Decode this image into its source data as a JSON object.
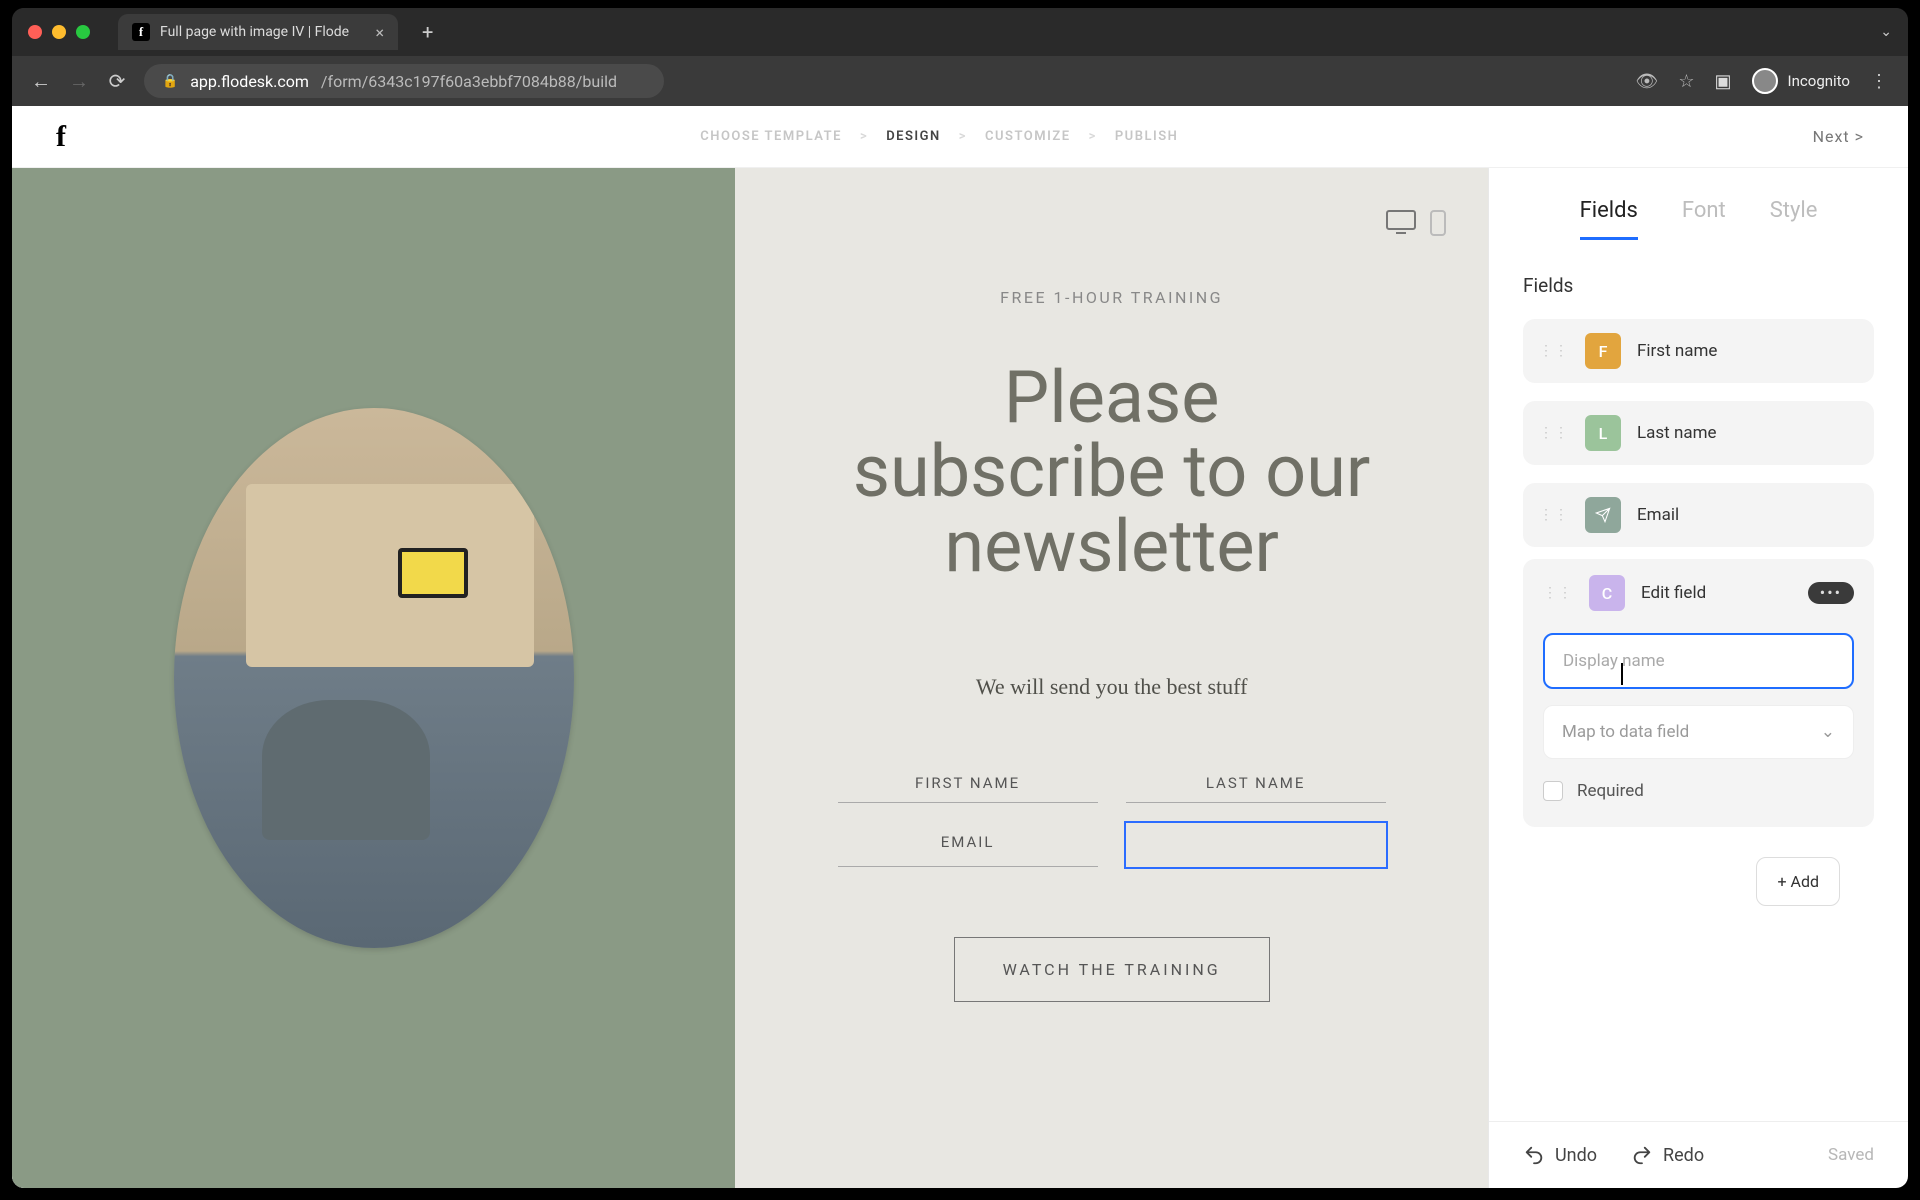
{
  "browser": {
    "tab_title": "Full page with image IV | Flode",
    "url_host": "app.flodesk.com",
    "url_path": "/form/6343c197f60a3ebbf7084b88/build",
    "incognito_label": "Incognito"
  },
  "header": {
    "crumbs": {
      "choose": "CHOOSE TEMPLATE",
      "design": "DESIGN",
      "customize": "CUSTOMIZE",
      "publish": "PUBLISH",
      "sep": ">"
    },
    "next": "Next  >"
  },
  "canvas": {
    "eyebrow": "FREE 1-HOUR TRAINING",
    "headline_l1": "Please",
    "headline_l2": "subscribe to our",
    "headline_l3": "newsletter",
    "sub": "We will send you the best stuff",
    "first_name_label": "FIRST NAME",
    "last_name_label": "LAST NAME",
    "email_label": "EMAIL",
    "cta": "WATCH THE TRAINING"
  },
  "sidebar": {
    "tabs": {
      "fields": "Fields",
      "font": "Font",
      "style": "Style"
    },
    "section_title": "Fields",
    "items": [
      {
        "letter": "F",
        "label": "First name",
        "chip": "orange"
      },
      {
        "letter": "L",
        "label": "Last name",
        "chip": "green"
      },
      {
        "letter": "",
        "label": "Email",
        "chip": "sage"
      }
    ],
    "edit": {
      "letter": "C",
      "title": "Edit field",
      "display_placeholder": "Display name",
      "map_label": "Map to data field",
      "required_label": "Required",
      "dots": "•••"
    },
    "add_label": "+ Add",
    "footer": {
      "undo": "Undo",
      "redo": "Redo",
      "saved": "Saved"
    }
  }
}
